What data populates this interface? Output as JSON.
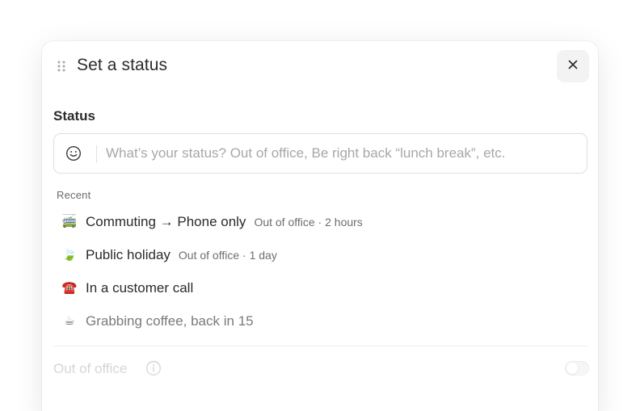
{
  "modal": {
    "title": "Set a status"
  },
  "status_section": {
    "label": "Status",
    "input": {
      "value": "",
      "placeholder": "What’s your status? Out of office, Be right back “lunch break”, etc."
    }
  },
  "recent": {
    "label": "Recent",
    "items": [
      {
        "emoji": "🚎",
        "text": "Commuting → Phone only",
        "meta": "Out of office · 2 hours"
      },
      {
        "emoji": "🍃",
        "text": "Public holiday",
        "meta": "Out of office · 1 day"
      },
      {
        "emoji": "☎️",
        "text": "In a customer call",
        "meta": ""
      },
      {
        "emoji": "☕",
        "text": "Grabbing coffee, back in 15",
        "meta": ""
      }
    ]
  },
  "out_of_office": {
    "label": "Out of office",
    "enabled": false
  },
  "icons": {
    "drag": "drag-handle-icon",
    "close": "close-icon",
    "emoji_picker": "smiley-icon",
    "info": "info-icon"
  },
  "colors": {
    "text": "#2b2b2b",
    "muted": "#6e6e6e",
    "placeholder": "#a7a7a7",
    "disabled": "#bcbcbc",
    "close_bg": "#f3f3f3"
  }
}
